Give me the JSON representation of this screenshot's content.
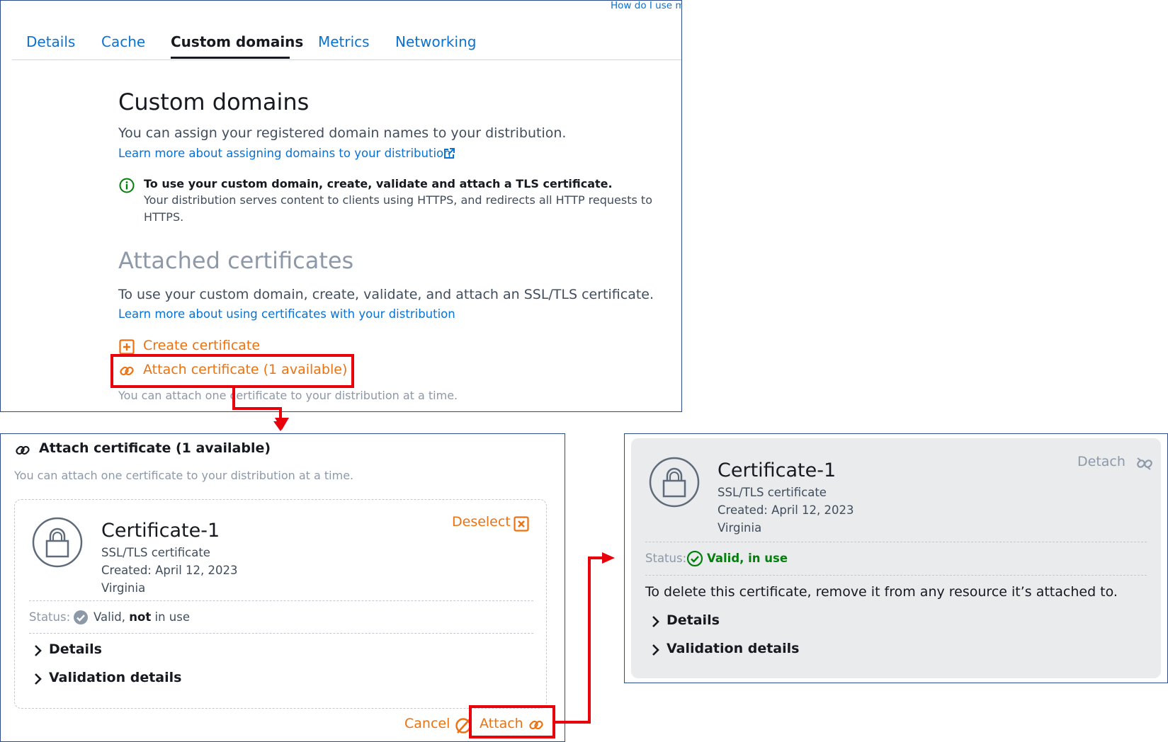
{
  "top_panel": {
    "corner_link": "How do I use my",
    "tabs": [
      {
        "label": "Details",
        "active": false
      },
      {
        "label": "Cache",
        "active": false
      },
      {
        "label": "Custom domains",
        "active": true
      },
      {
        "label": "Metrics",
        "active": false
      },
      {
        "label": "Networking",
        "active": false
      }
    ],
    "title": "Custom domains",
    "description": "You can assign your registered domain names to your distribution.",
    "learn_more_domains": "Learn more about assigning domains to your distribution",
    "info_bold": "To use your custom domain, create, validate and attach a TLS certificate.",
    "info_line1": "Your distribution serves content to clients using HTTPS, and redirects all HTTP requests to",
    "info_line2": "HTTPS.",
    "attached_title": "Attached certificates",
    "attached_desc": "To use your custom domain, create, validate, and attach an SSL/TLS certificate.",
    "learn_more_certs": "Learn more about using certificates with your distribution",
    "create_certificate": "Create certificate",
    "attach_certificate": "Attach certificate (1 available)",
    "attach_hint": "You can attach one certificate to your distribution at a time."
  },
  "attach_panel": {
    "title": "Attach certificate (1 available)",
    "hint": "You can attach one certificate to your distribution at a time.",
    "card": {
      "name": "Certificate-1",
      "type": "SSL/TLS certificate",
      "created": "Created: April 12, 2023",
      "region": "Virginia",
      "deselect": "Deselect",
      "status_label": "Status:",
      "status_valid": "Valid,",
      "status_not": "not",
      "status_in_use": "in use",
      "details": "Details",
      "validation_details": "Validation details"
    },
    "cancel": "Cancel",
    "attach": "Attach"
  },
  "result_panel": {
    "name": "Certificate-1",
    "type": "SSL/TLS certificate",
    "created": "Created: April 12, 2023",
    "region": "Virginia",
    "detach": "Detach",
    "status_label": "Status:",
    "status_value": "Valid, in use",
    "delete_note": "To delete this certificate, remove it from any resource it’s attached to.",
    "details": "Details",
    "validation_details": "Validation details"
  },
  "colors": {
    "link": "#0972d3",
    "orange": "#ec7211",
    "highlight": "#e8000b",
    "success": "#037f0c",
    "panel_border": "#2f4b8f",
    "gray_card": "#e9ebed"
  }
}
